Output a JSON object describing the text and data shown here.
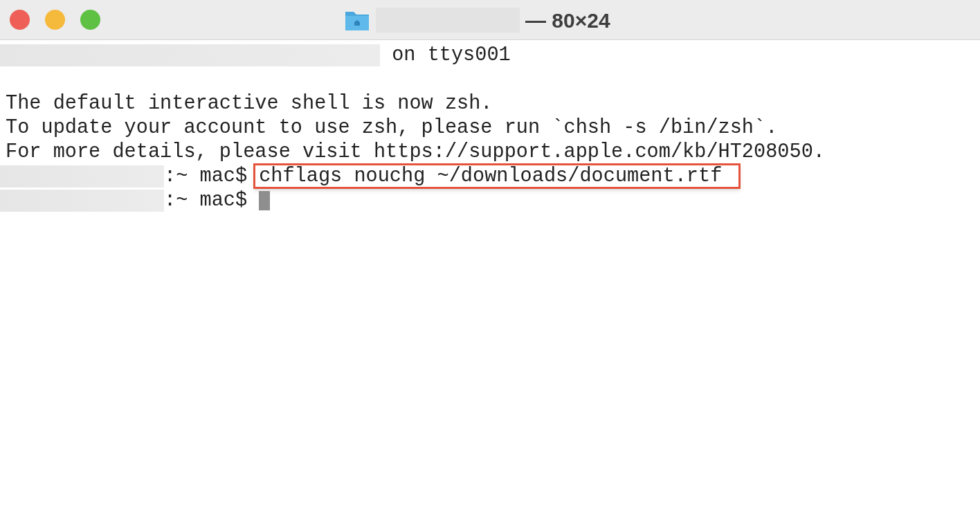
{
  "window": {
    "title": "— 80×24",
    "title_redacted": true
  },
  "lines": [
    {
      "segments": [
        {
          "kind": "redacted"
        },
        {
          "kind": "text",
          "text": " on ttys001"
        }
      ]
    },
    {
      "segments": [
        {
          "kind": "blank"
        }
      ]
    },
    {
      "segments": [
        {
          "kind": "text",
          "text": "The default interactive shell is now zsh."
        }
      ]
    },
    {
      "segments": [
        {
          "kind": "text",
          "text": "To update your account to use zsh, please run `chsh -s /bin/zsh`."
        }
      ]
    },
    {
      "segments": [
        {
          "kind": "text",
          "text": "For more details, please visit https://support.apple.com/kb/HT208050."
        }
      ]
    },
    {
      "segments": [
        {
          "kind": "redacted"
        },
        {
          "kind": "prompt",
          "text": ":~ mac$"
        },
        {
          "kind": "command",
          "text": "chflags nouchg ~/downloads/document.rtf",
          "highlighted": true
        }
      ]
    },
    {
      "segments": [
        {
          "kind": "redacted"
        },
        {
          "kind": "prompt",
          "text": ":~ mac$"
        },
        {
          "kind": "cursor"
        }
      ]
    }
  ]
}
